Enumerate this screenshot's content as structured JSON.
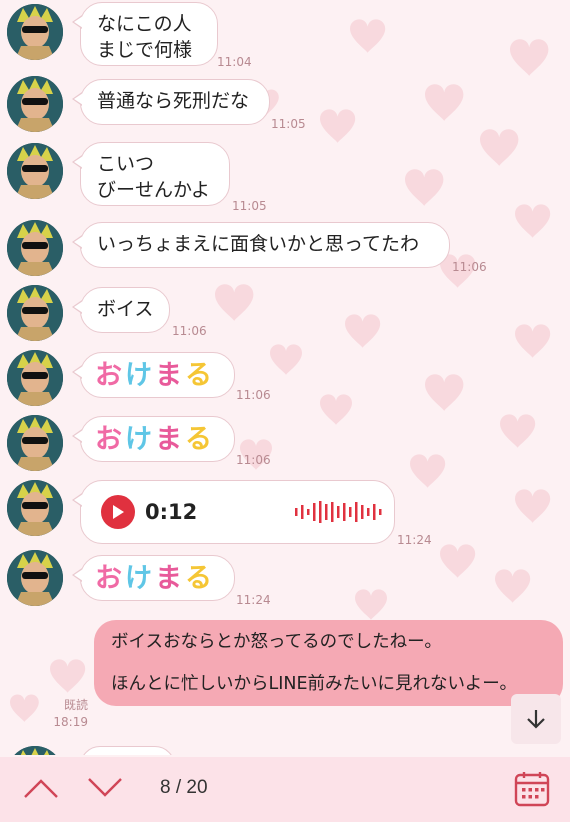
{
  "messages": [
    {
      "type": "text",
      "lines": [
        "なにこの人",
        "まじで何様"
      ],
      "time": "11:04"
    },
    {
      "type": "text",
      "lines": [
        "普通なら死刑だな"
      ],
      "time": "11:05"
    },
    {
      "type": "text",
      "lines": [
        "こいつ",
        "びーせんかよ"
      ],
      "time": "11:05"
    },
    {
      "type": "text",
      "lines": [
        "いっちょまえに面食いかと思ってたわ"
      ],
      "time": "11:06"
    },
    {
      "type": "text",
      "lines": [
        "ボイス"
      ],
      "time": "11:06"
    },
    {
      "type": "sticker",
      "chars": [
        "お",
        "け",
        "ま",
        "る"
      ],
      "time": "11:06"
    },
    {
      "type": "sticker",
      "chars": [
        "お",
        "け",
        "ま",
        "る"
      ],
      "time": "11:06"
    },
    {
      "type": "voice",
      "duration": "0:12",
      "time": "11:24"
    },
    {
      "type": "sticker",
      "chars": [
        "お",
        "け",
        "ま",
        "る"
      ],
      "time": "11:24"
    }
  ],
  "outgoing": {
    "paragraphs": [
      "ボイスおならとか怒ってるのでしたねー。",
      "ほんとに忙しいからLINE前みたいに見れないよー。"
    ],
    "read_label": "既読",
    "time": "18:19"
  },
  "search_nav": {
    "current": "8",
    "separator": "/",
    "total": "20"
  },
  "icons": {
    "scroll_down": "arrow-down-icon",
    "prev": "chevron-up-icon",
    "next": "chevron-down-icon",
    "calendar": "calendar-icon",
    "play": "play-icon"
  },
  "colors": {
    "accent": "#e0313f",
    "outgoing_bubble": "#f5a9b4",
    "bottom_bar": "#fce2e8",
    "background": "#fdf1f3"
  }
}
